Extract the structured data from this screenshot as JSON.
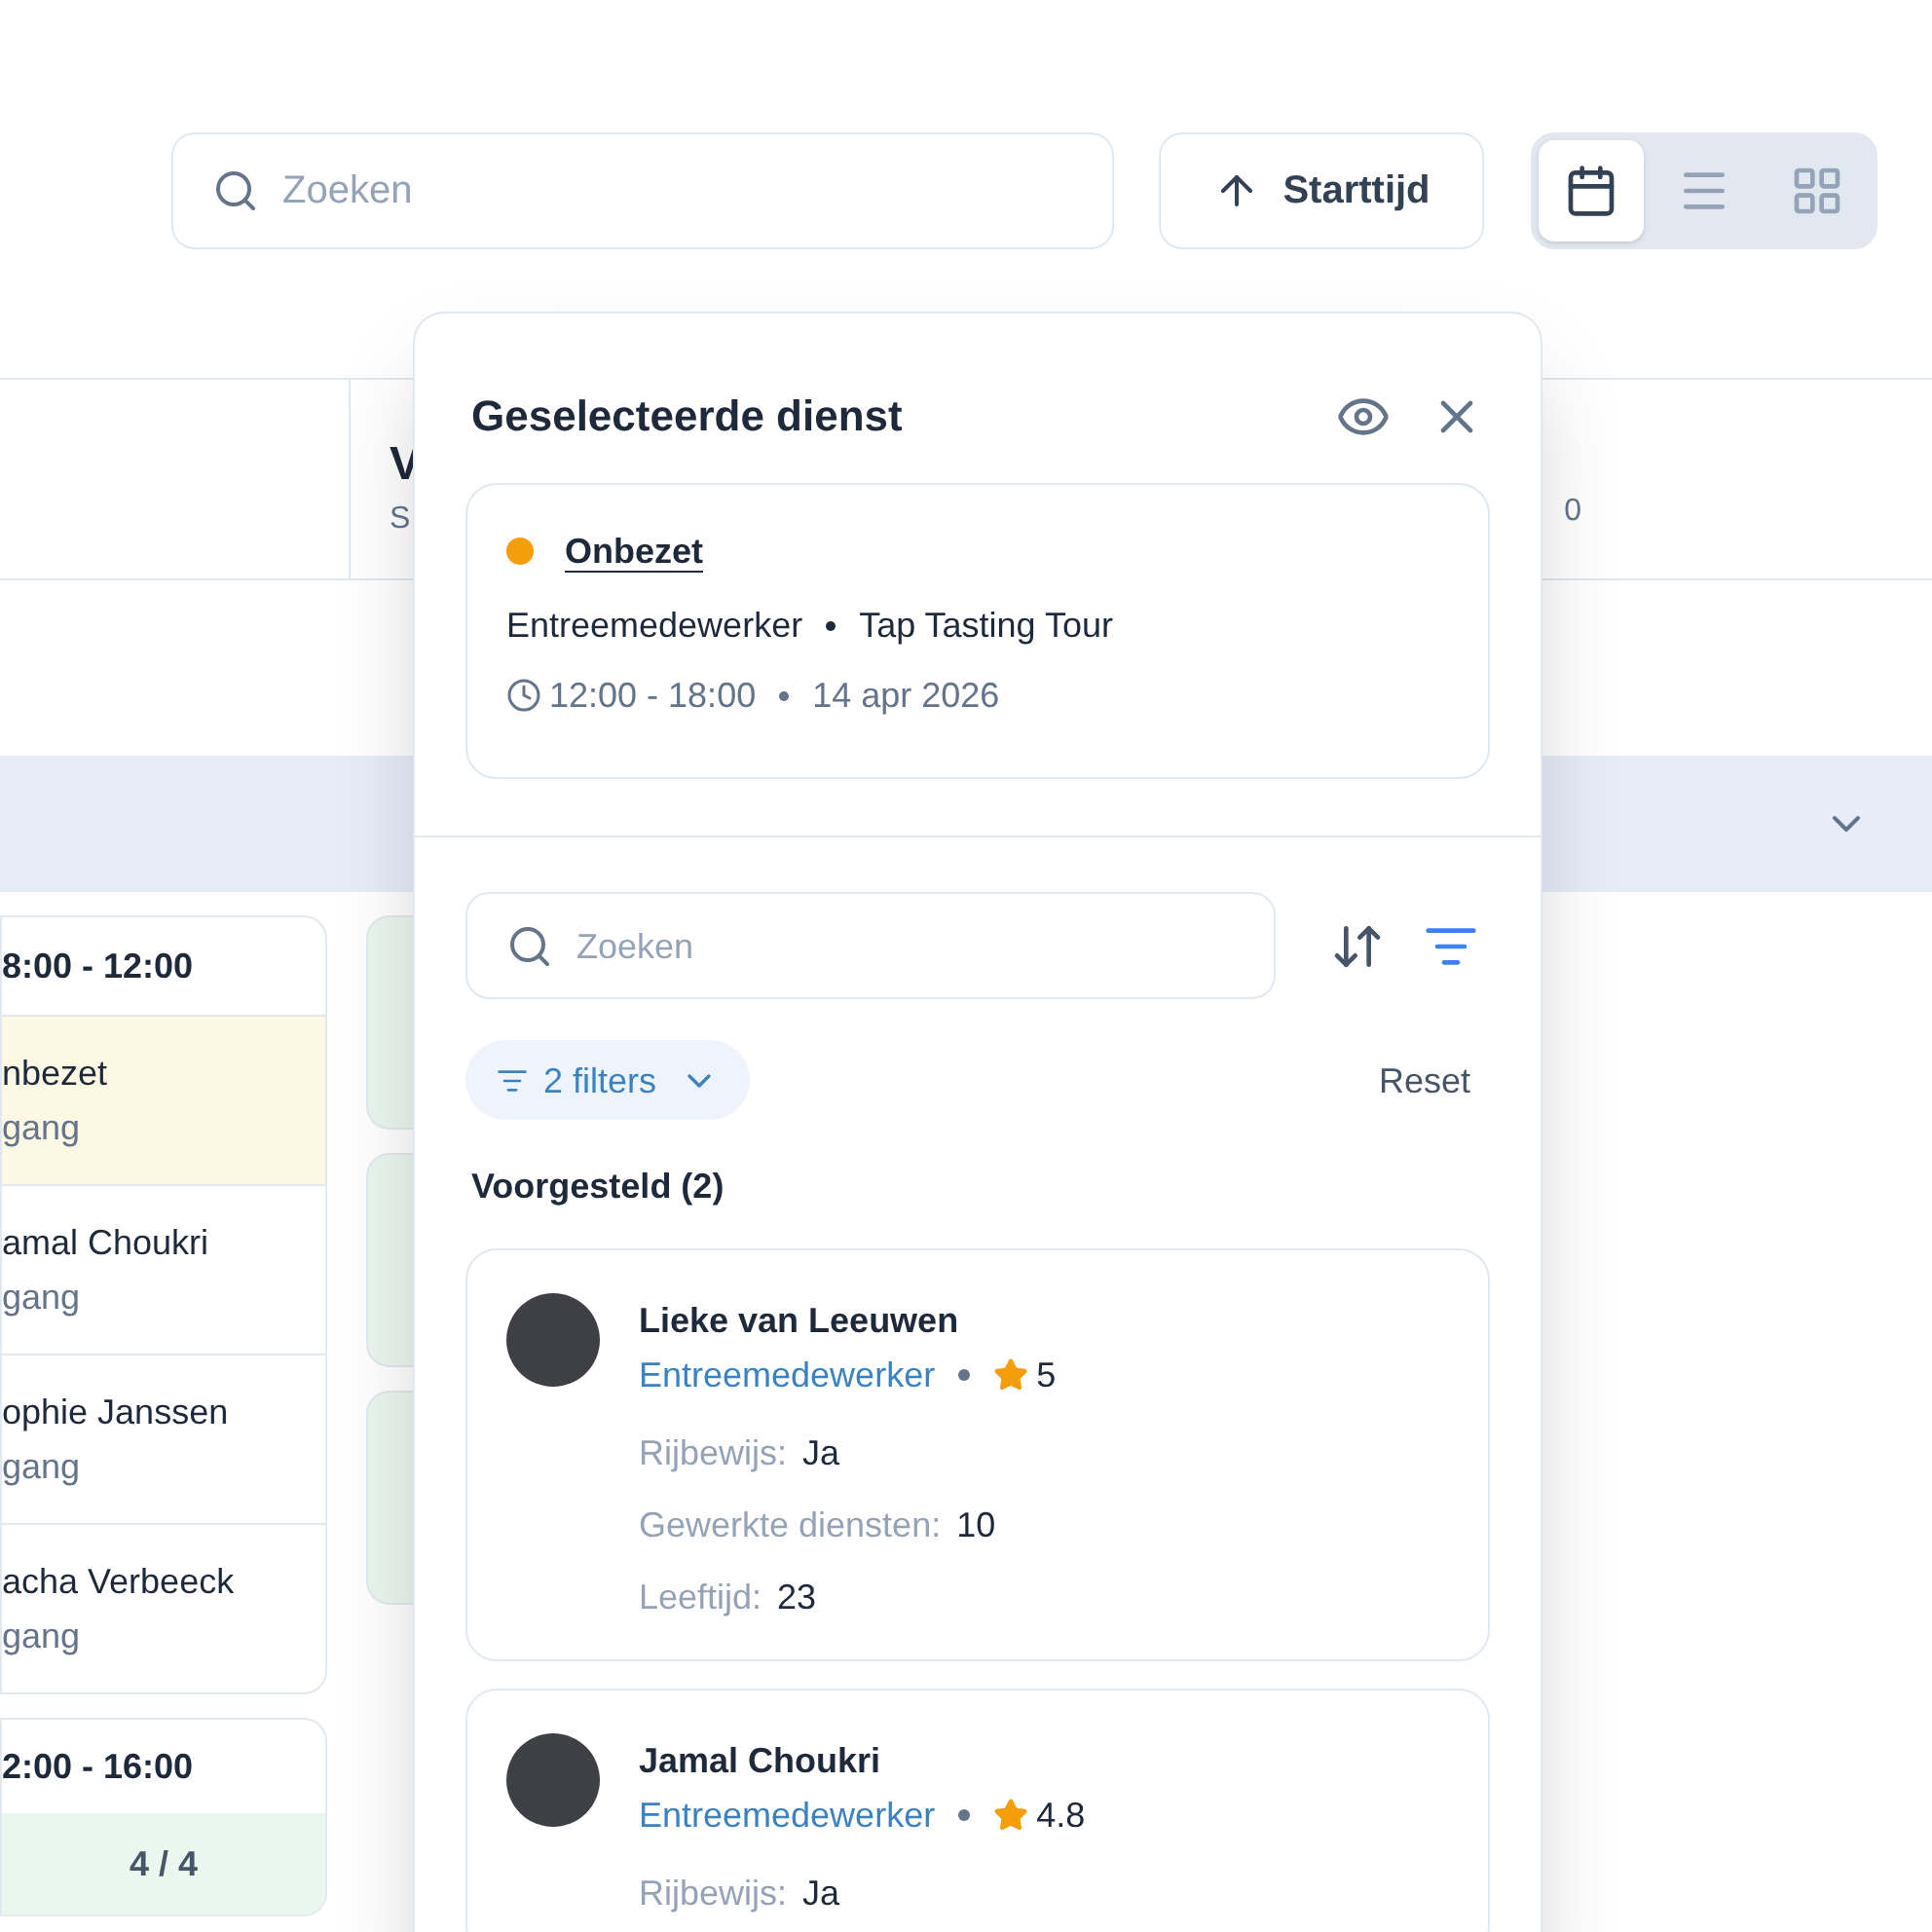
{
  "toolbar": {
    "search": {
      "placeholder": "Zoeken"
    },
    "sort_button": {
      "label": "Starttijd"
    },
    "views": [
      {
        "kind": "calendar",
        "selected": true
      },
      {
        "kind": "list",
        "selected": false
      },
      {
        "kind": "grid",
        "selected": false
      }
    ]
  },
  "schedule": {
    "column_header": {
      "title": "V",
      "subtitle": "S"
    },
    "column_3_header": "0",
    "slots": [
      {
        "time": "8:00 - 12:00",
        "entries": [
          {
            "name": "nbezet",
            "detail": "gang",
            "highlighted": true
          },
          {
            "name": "amal Choukri",
            "detail": "gang",
            "highlighted": false
          },
          {
            "name": "ophie Janssen",
            "detail": "gang",
            "highlighted": false
          },
          {
            "name": "acha Verbeeck",
            "detail": "gang",
            "highlighted": false
          }
        ]
      },
      {
        "time": "2:00 - 16:00",
        "count": "4 / 4"
      }
    ]
  },
  "panel": {
    "title": "Geselecteerde dienst",
    "shift": {
      "status": "Onbezet",
      "color": "#f59e0b",
      "role": "Entreemedewerker",
      "event": "Tap Tasting Tour",
      "time": "12:00 - 18:00",
      "date": "14 apr 2026"
    },
    "search": {
      "placeholder": "Zoeken"
    },
    "filter_chip": "2 filters",
    "reset": "Reset",
    "section_title": "Voorgesteld (2)",
    "candidates": [
      {
        "name": "Lieke van Leeuwen",
        "role": "Entreemedewerker",
        "rating": "5",
        "details": [
          {
            "label": "Rijbewijs:",
            "value": "Ja"
          },
          {
            "label": "Gewerkte diensten:",
            "value": "10"
          },
          {
            "label": "Leeftijd:",
            "value": "23"
          }
        ]
      },
      {
        "name": "Jamal Choukri",
        "role": "Entreemedewerker",
        "rating": "4.8",
        "details": [
          {
            "label": "Rijbewijs:",
            "value": "Ja"
          }
        ]
      }
    ]
  }
}
